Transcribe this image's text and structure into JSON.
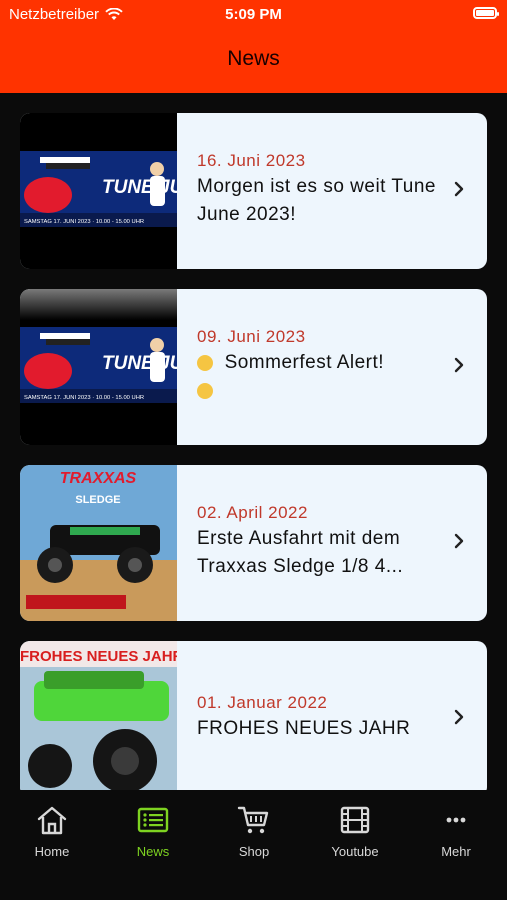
{
  "status": {
    "carrier": "Netzbetreiber",
    "time": "5:09 PM"
  },
  "header": {
    "title": "News"
  },
  "news": [
    {
      "date": "16. Juni 2023",
      "title": "Morgen ist es so weit Tune June 2023!"
    },
    {
      "date": "09. Juni 2023",
      "title": "Sommerfest Alert!"
    },
    {
      "date": "02. April 2022",
      "title": "Erste Ausfahrt mit dem Traxxas Sledge 1/8 4..."
    },
    {
      "date": "01. Januar 2022",
      "title": "FROHES NEUES JAHR"
    }
  ],
  "thumbs": {
    "tune_june": {
      "big": "TUNE JUNE",
      "sub": "SAMSTAG 17. JUNI 2023 · 10.00 - 15.00 UHR"
    },
    "traxxas": {
      "brand": "TRAXXAS",
      "model": "SLEDGE"
    },
    "neujahr": {
      "text": "FROHES NEUES JAHR"
    }
  },
  "tabs": [
    {
      "label": "Home",
      "icon": "home-icon"
    },
    {
      "label": "News",
      "icon": "news-list-icon"
    },
    {
      "label": "Shop",
      "icon": "cart-icon"
    },
    {
      "label": "Youtube",
      "icon": "film-icon"
    },
    {
      "label": "Mehr",
      "icon": "more-icon"
    }
  ],
  "colors": {
    "header": "#ff3300",
    "accent": "#7ed321",
    "date": "#c0392b",
    "card": "#eef6fd"
  }
}
